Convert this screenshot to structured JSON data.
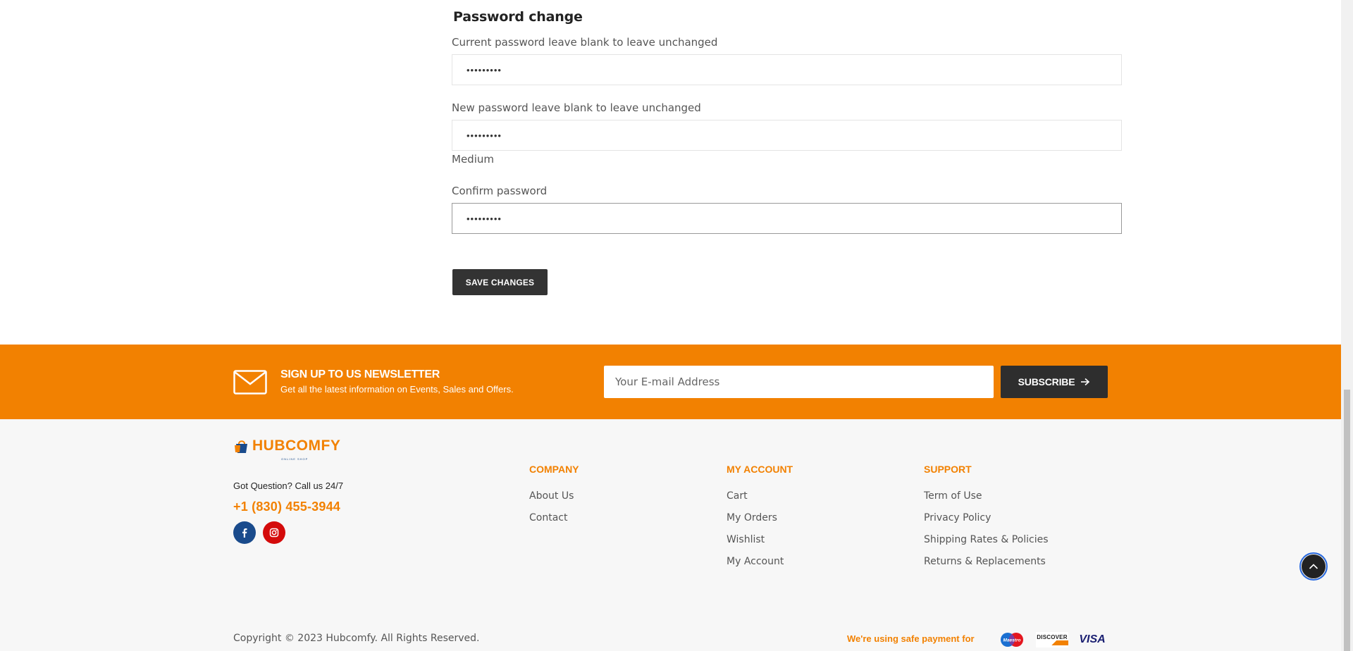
{
  "password_change": {
    "title": "Password change",
    "current_label": "Current password leave blank to leave unchanged",
    "current_value": "•••••••••",
    "new_label": "New password leave blank to leave unchanged",
    "new_value": "•••••••••",
    "strength": "Medium",
    "confirm_label": "Confirm password",
    "confirm_value": "•••••••••",
    "save_label": "SAVE CHANGES"
  },
  "newsletter": {
    "title": "SIGN UP TO US NEWSLETTER",
    "subtitle": "Get all the latest information on Events, Sales and Offers.",
    "email_placeholder": "Your E-mail Address",
    "subscribe_label": "SUBSCRIBE",
    "icon": "envelope-icon"
  },
  "footer": {
    "logo": "HUBCOMFY",
    "logo_tagline": "ONLINE SHOP",
    "question": "Got Question? Call us 24/7",
    "phone": "+1 (830) 455-3944",
    "social": [
      "facebook-icon",
      "instagram-icon"
    ],
    "columns": [
      {
        "title": "COMPANY",
        "links": [
          "About Us",
          "Contact"
        ]
      },
      {
        "title": "MY ACCOUNT",
        "links": [
          "Cart",
          "My Orders",
          "Wishlist",
          "My Account"
        ]
      },
      {
        "title": "SUPPORT",
        "links": [
          "Term of Use",
          "Privacy Policy",
          "Shipping Rates & Policies",
          "Returns & Replacements"
        ]
      }
    ],
    "copyright": "Copyright © 2023 Hubcomfy. All Rights Reserved.",
    "payment_label": "We're using safe payment for",
    "payment_methods": [
      "Maestro",
      "DISCOVER",
      "VISA"
    ]
  },
  "colors": {
    "accent": "#f28101",
    "dark": "#333333",
    "facebook": "#1a4b8c",
    "instagram": "#d40b0b"
  }
}
